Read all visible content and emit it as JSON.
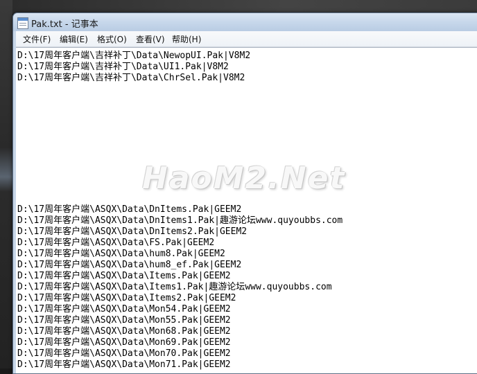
{
  "window": {
    "title": "Pak.txt - 记事本"
  },
  "menu": [
    {
      "label": "文件(F)"
    },
    {
      "label": "编辑(E)"
    },
    {
      "label": "格式(O)"
    },
    {
      "label": "查看(V)"
    },
    {
      "label": "帮助(H)"
    }
  ],
  "lines_top": [
    "D:\\17周年客户端\\吉祥补丁\\Data\\NewopUI.Pak|V8M2",
    "D:\\17周年客户端\\吉祥补丁\\Data\\UI1.Pak|V8M2",
    "D:\\17周年客户端\\吉祥补丁\\Data\\ChrSel.Pak|V8M2"
  ],
  "lines_bottom": [
    "D:\\17周年客户端\\ASQX\\Data\\DnItems.Pak|GEEM2",
    "D:\\17周年客户端\\ASQX\\Data\\DnItems1.Pak|趣游论坛www.quyoubbs.com",
    "D:\\17周年客户端\\ASQX\\Data\\DnItems2.Pak|GEEM2",
    "D:\\17周年客户端\\ASQX\\Data\\FS.Pak|GEEM2",
    "D:\\17周年客户端\\ASQX\\Data\\hum8.Pak|GEEM2",
    "D:\\17周年客户端\\ASQX\\Data\\hum8_ef.Pak|GEEM2",
    "D:\\17周年客户端\\ASQX\\Data\\Items.Pak|GEEM2",
    "D:\\17周年客户端\\ASQX\\Data\\Items1.Pak|趣游论坛www.quyoubbs.com",
    "D:\\17周年客户端\\ASQX\\Data\\Items2.Pak|GEEM2",
    "D:\\17周年客户端\\ASQX\\Data\\Mon54.Pak|GEEM2",
    "D:\\17周年客户端\\ASQX\\Data\\Mon55.Pak|GEEM2",
    "D:\\17周年客户端\\ASQX\\Data\\Mon68.Pak|GEEM2",
    "D:\\17周年客户端\\ASQX\\Data\\Mon69.Pak|GEEM2",
    "D:\\17周年客户端\\ASQX\\Data\\Mon70.Pak|GEEM2",
    "D:\\17周年客户端\\ASQX\\Data\\Mon71.Pak|GEEM2"
  ],
  "watermark": {
    "text": "HaoM2.Net"
  }
}
